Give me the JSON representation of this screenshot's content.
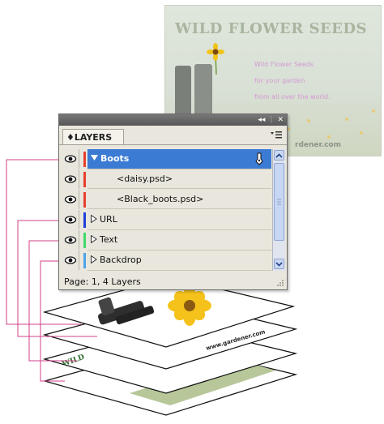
{
  "document": {
    "title": "WILD FLOWER SEEDS",
    "tagline": [
      "Wild Flower Seeds",
      "for your garden",
      "from all over the world."
    ],
    "url_fragment": "rdener.com"
  },
  "panel": {
    "tab_label": "♦LAYERS",
    "topbar_icons": [
      "collapse-icon",
      "close-icon"
    ],
    "topbar_text": {
      "collapse": "◂◂",
      "close": "✕"
    },
    "menu_icon": "panel-menu-icon",
    "layers": [
      {
        "name": "Boots",
        "expanded": true,
        "selected": true,
        "color": "#e8402e",
        "visible": true
      },
      {
        "name": "<daisy.psd>",
        "sublayer": true,
        "color": "#e8402e",
        "visible": true
      },
      {
        "name": "<Black_boots.psd>",
        "sublayer": true,
        "color": "#e8402e",
        "visible": true
      },
      {
        "name": "URL",
        "expanded": false,
        "color": "#1f3fd8",
        "visible": true
      },
      {
        "name": "Text",
        "expanded": false,
        "color": "#3fd96a",
        "visible": true
      },
      {
        "name": "Backdrop",
        "expanded": false,
        "color": "#4aa4e8",
        "visible": true
      }
    ],
    "status": "Page: 1, 4 Layers"
  },
  "illustration": {
    "sheet_texts": [
      "www.gardener.com",
      "WILD"
    ],
    "connector_color": "#d1408a"
  },
  "colors": {
    "selection": "#3b7bd4",
    "panel_bg": "#e9e6dd",
    "accent_pink": "#d1408a"
  }
}
